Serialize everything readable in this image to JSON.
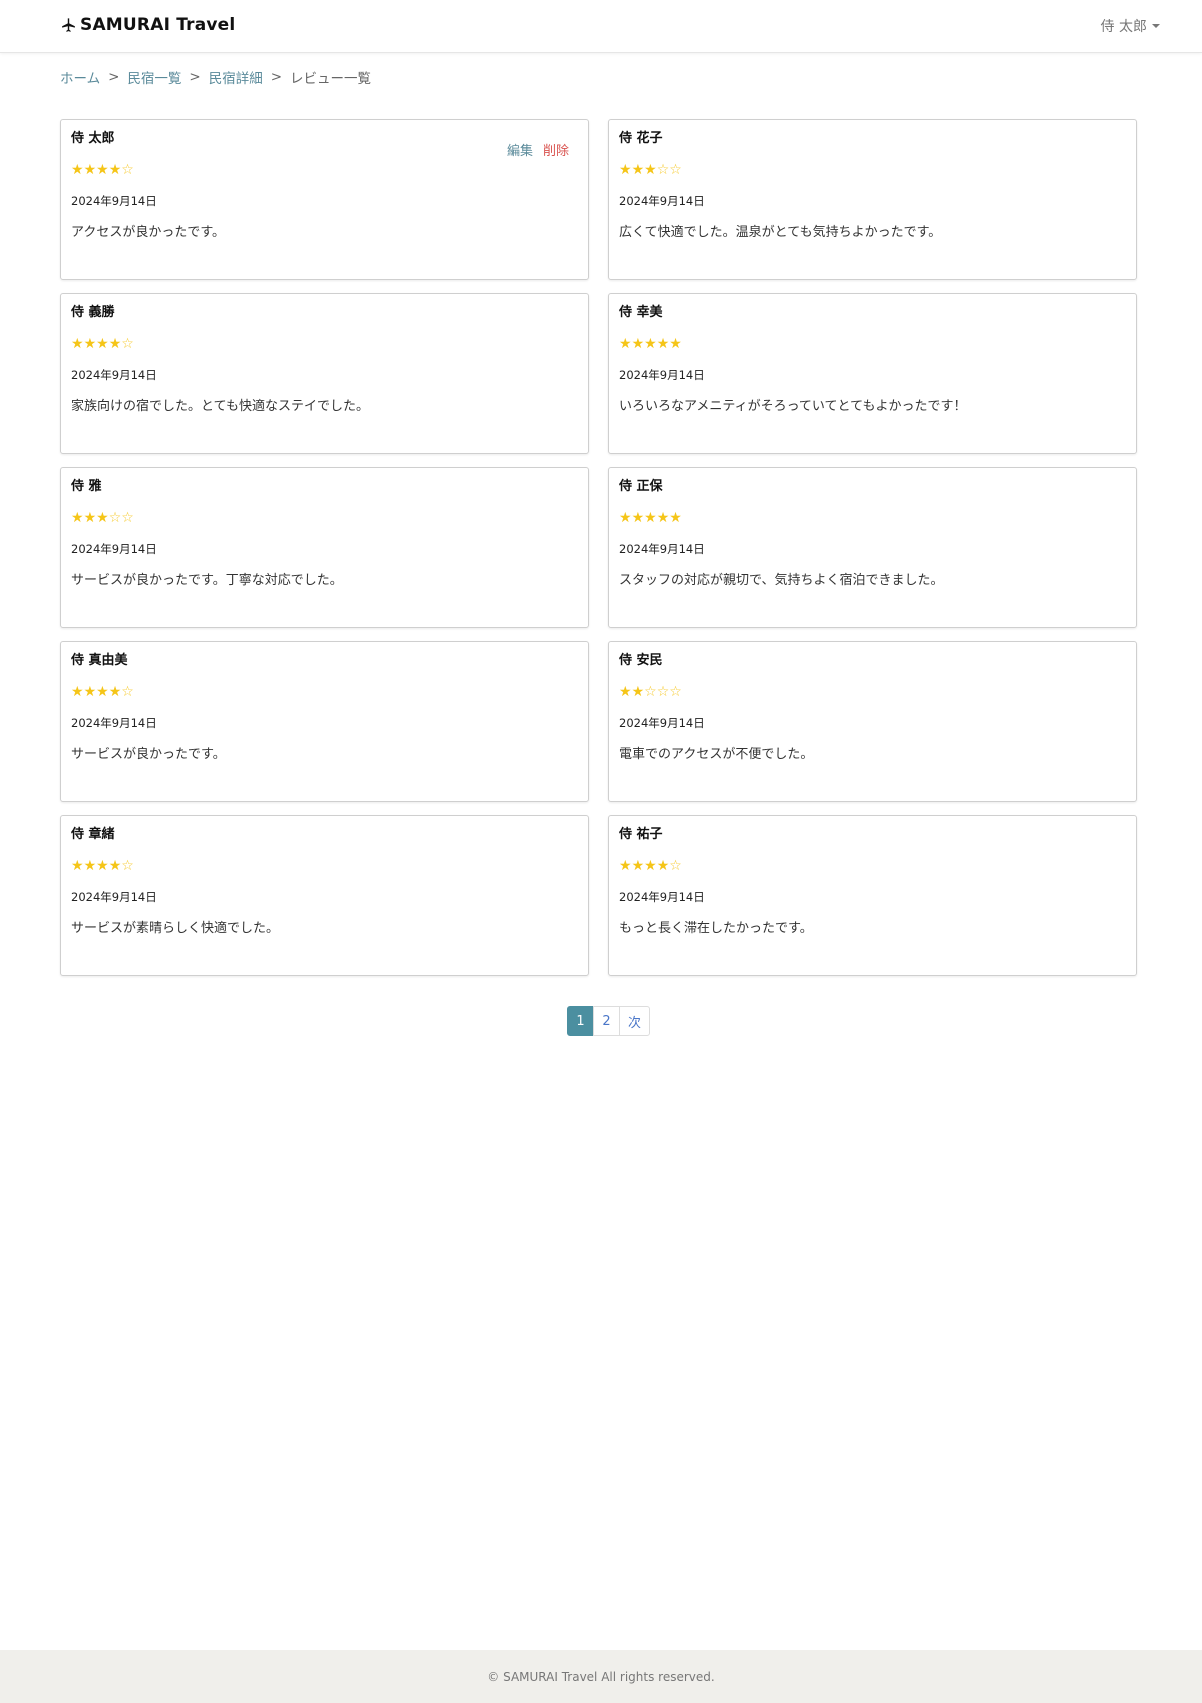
{
  "header": {
    "brand": "SAMURAI Travel",
    "brand_icon": "airplane-icon",
    "user_menu": "侍 太郎"
  },
  "breadcrumb": {
    "items": [
      "ホーム",
      "民宿一覧",
      "民宿詳細"
    ],
    "separator": ">",
    "current": "レビュー一覧"
  },
  "review_actions": {
    "edit": "編集",
    "delete": "削除"
  },
  "reviews": [
    {
      "name": "侍 太郎",
      "rating": 4,
      "max": 5,
      "date": "2024年9月14日",
      "comment": "アクセスが良かったです。",
      "own": true
    },
    {
      "name": "侍 花子",
      "rating": 3,
      "max": 5,
      "date": "2024年9月14日",
      "comment": "広くて快適でした。温泉がとても気持ちよかったです。",
      "own": false
    },
    {
      "name": "侍 義勝",
      "rating": 4,
      "max": 5,
      "date": "2024年9月14日",
      "comment": "家族向けの宿でした。とても快適なステイでした。",
      "own": false
    },
    {
      "name": "侍 幸美",
      "rating": 5,
      "max": 5,
      "date": "2024年9月14日",
      "comment": "いろいろなアメニティがそろっていてとてもよかったです！",
      "own": false
    },
    {
      "name": "侍 雅",
      "rating": 3,
      "max": 5,
      "date": "2024年9月14日",
      "comment": "サービスが良かったです。丁寧な対応でした。",
      "own": false
    },
    {
      "name": "侍 正保",
      "rating": 5,
      "max": 5,
      "date": "2024年9月14日",
      "comment": "スタッフの対応が親切で、気持ちよく宿泊できました。",
      "own": false
    },
    {
      "name": "侍 真由美",
      "rating": 4,
      "max": 5,
      "date": "2024年9月14日",
      "comment": "サービスが良かったです。",
      "own": false
    },
    {
      "name": "侍 安民",
      "rating": 2,
      "max": 5,
      "date": "2024年9月14日",
      "comment": "電車でのアクセスが不便でした。",
      "own": false
    },
    {
      "name": "侍 章緒",
      "rating": 4,
      "max": 5,
      "date": "2024年9月14日",
      "comment": "サービスが素晴らしく快適でした。",
      "own": false
    },
    {
      "name": "侍 祐子",
      "rating": 4,
      "max": 5,
      "date": "2024年9月14日",
      "comment": "もっと長く滞在したかったです。",
      "own": false
    }
  ],
  "pagination": {
    "pages": [
      "1",
      "2"
    ],
    "current": "1",
    "next": "次"
  },
  "footer": {
    "copyright": "© SAMURAI Travel All rights reserved."
  },
  "colors": {
    "star": "#f5c518",
    "link": "#5a8a9a",
    "delete": "#d9534f",
    "page_active": "#4b8fa0",
    "footer_bg": "#f0efeb"
  }
}
